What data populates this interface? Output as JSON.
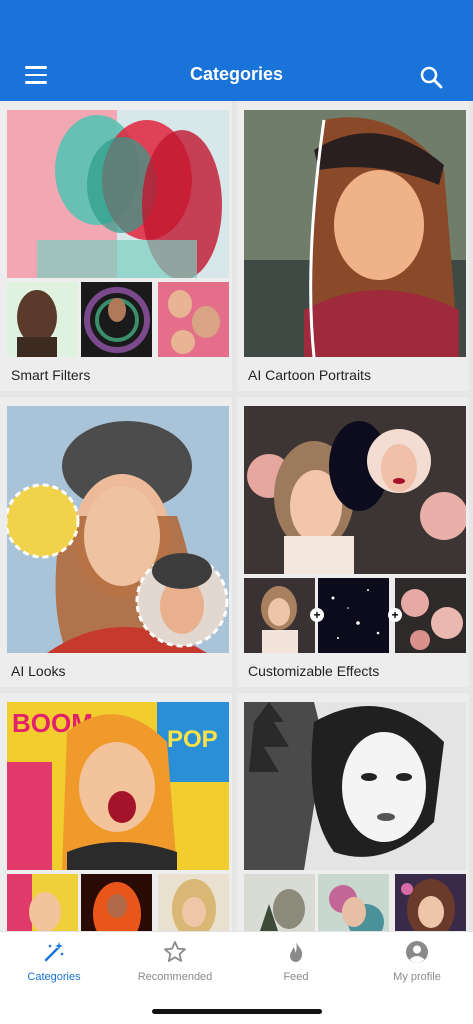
{
  "header": {
    "title": "Categories",
    "menu_icon": "hamburger-menu-icon",
    "search_icon": "search-icon",
    "background": "#1a73d9"
  },
  "categories": [
    {
      "label": "Smart Filters"
    },
    {
      "label": "AI Cartoon Portraits"
    },
    {
      "label": "AI Looks"
    },
    {
      "label": "Customizable Effects"
    },
    {
      "label": ""
    },
    {
      "label": ""
    }
  ],
  "tabbar": {
    "active_color": "#1a73d9",
    "tabs": [
      {
        "label": "Categories",
        "icon": "magic-wand-icon",
        "active": true
      },
      {
        "label": "Recommended",
        "icon": "star-icon",
        "active": false
      },
      {
        "label": "Feed",
        "icon": "flame-icon",
        "active": false
      },
      {
        "label": "My profile",
        "icon": "avatar-icon",
        "active": false
      }
    ]
  }
}
